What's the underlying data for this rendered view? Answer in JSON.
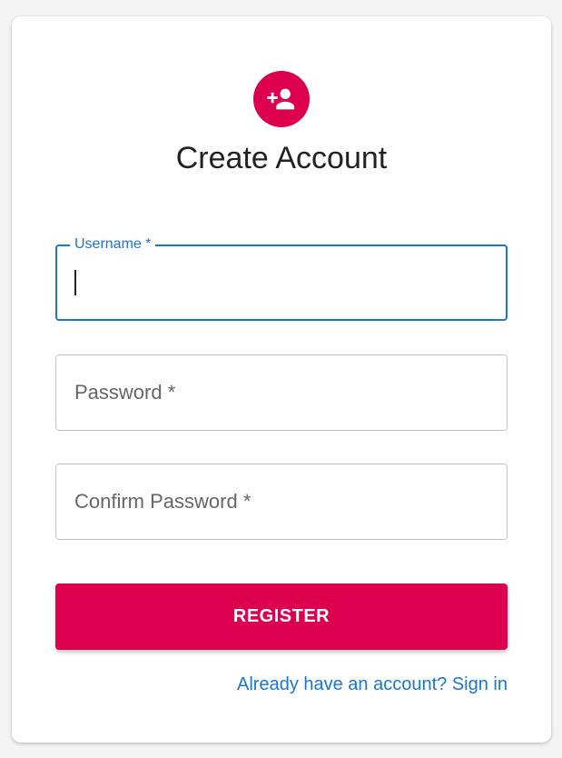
{
  "form": {
    "title": "Create Account",
    "icon": "person-add-icon",
    "accent_color": "#dc004e",
    "focus_color": "#1976d2",
    "fields": {
      "username": {
        "label": "Username *",
        "value": ""
      },
      "password": {
        "label": "Password *",
        "value": ""
      },
      "confirm_password": {
        "label": "Confirm Password *",
        "value": ""
      }
    },
    "submit_label": "REGISTER",
    "signin_link": "Already have an account? Sign in"
  }
}
